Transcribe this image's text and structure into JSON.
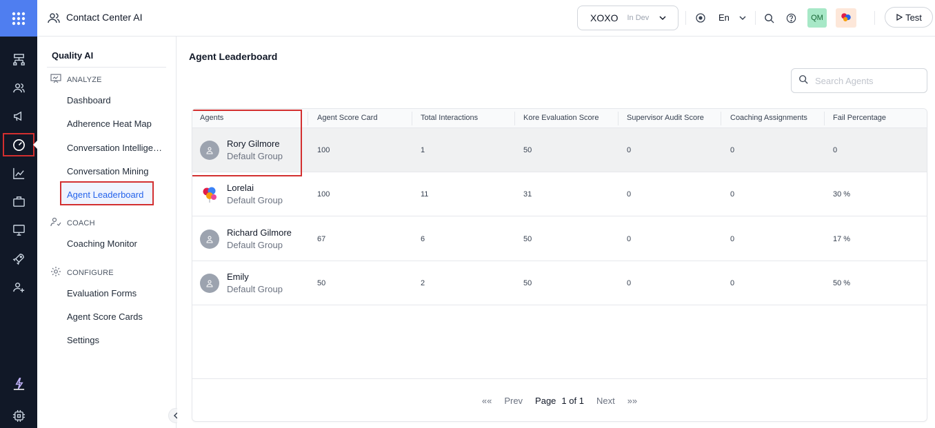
{
  "topbar": {
    "app_title": "Contact Center AI",
    "env_name": "XOXO",
    "env_stage": "In Dev",
    "language": "En",
    "user_initials": "QM",
    "test_label": "Test"
  },
  "subnav": {
    "title": "Quality AI",
    "sections": {
      "analyze": "ANALYZE",
      "coach": "COACH",
      "configure": "CONFIGURE"
    },
    "items": {
      "dashboard": "Dashboard",
      "heatmap": "Adherence Heat Map",
      "conv_intel": "Conversation Intelligence",
      "conv_mining": "Conversation Mining",
      "leaderboard": "Agent Leaderboard",
      "coaching_monitor": "Coaching Monitor",
      "eval_forms": "Evaluation Forms",
      "score_cards": "Agent Score Cards",
      "settings": "Settings"
    },
    "active": "Agent Leaderboard"
  },
  "main": {
    "title": "Agent Leaderboard",
    "search_placeholder": "Search Agents",
    "columns": [
      "Agents",
      "Agent Score Card",
      "Total Interactions",
      "Kore Evaluation Score",
      "Supervisor Audit Score",
      "Coaching Assignments",
      "Fail Percentage"
    ],
    "rows": [
      {
        "name": "Rory Gilmore",
        "group": "Default Group",
        "score_card": "100",
        "interactions": "1",
        "kore": "50",
        "supervisor": "0",
        "coaching": "0",
        "fail": "0"
      },
      {
        "name": "Lorelai",
        "group": "Default Group",
        "score_card": "100",
        "interactions": "11",
        "kore": "31",
        "supervisor": "0",
        "coaching": "0",
        "fail": "30 %"
      },
      {
        "name": "Richard Gilmore",
        "group": "Default Group",
        "score_card": "67",
        "interactions": "6",
        "kore": "50",
        "supervisor": "0",
        "coaching": "0",
        "fail": "17 %"
      },
      {
        "name": "Emily",
        "group": "Default Group",
        "score_card": "50",
        "interactions": "2",
        "kore": "50",
        "supervisor": "0",
        "coaching": "0",
        "fail": "50 %"
      }
    ],
    "pager": {
      "first": "««",
      "prev": "Prev",
      "page_label": "Page",
      "page_value": "1 of 1",
      "next": "Next",
      "last": "»»"
    }
  },
  "colors": {
    "rail_bg": "#111827",
    "apps_bg": "#4f7ef0",
    "highlight": "#d32f2f",
    "active_link": "#2563eb"
  },
  "icons": {
    "rail": [
      "apps-grid-icon",
      "flow-icon",
      "users-icon",
      "megaphone-icon",
      "gauge-icon",
      "chart-icon",
      "briefcase-icon",
      "monitor-icon",
      "rocket-icon",
      "user-plus-icon",
      "lightning-icon",
      "chip-icon"
    ]
  }
}
